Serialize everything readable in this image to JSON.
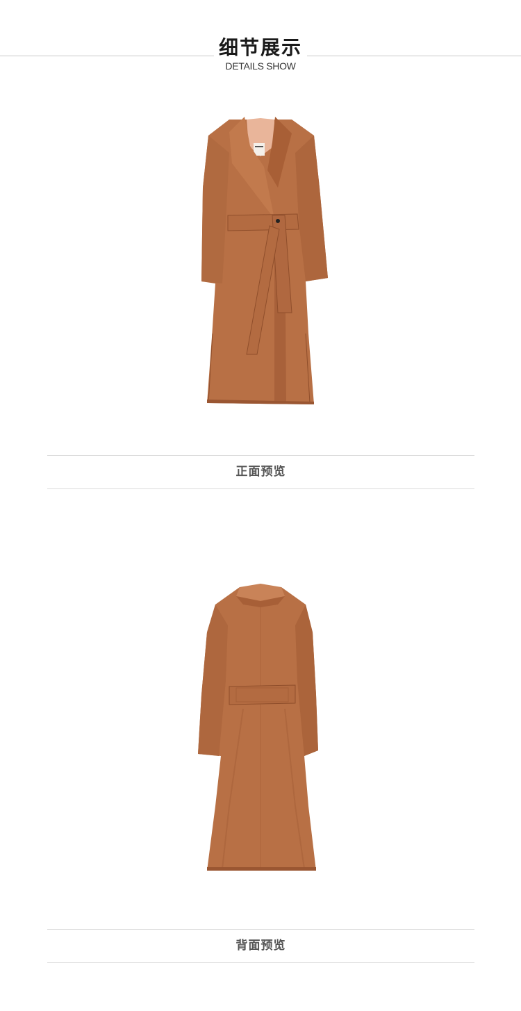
{
  "section_header": {
    "title_cn": "细节展示",
    "title_en": "DETAILS SHOW"
  },
  "front_view": {
    "caption": "正面预览",
    "image": "camel-belted-wool-coat-front",
    "label_tag": "label-icon"
  },
  "back_view": {
    "caption": "背面预览",
    "image": "camel-belted-wool-coat-back"
  },
  "colors": {
    "coat": "#b87045",
    "coat_shadow": "#9a5632",
    "coat_highlight": "#c98358",
    "rule": "#c8c8c8",
    "caption_text": "#555555"
  }
}
